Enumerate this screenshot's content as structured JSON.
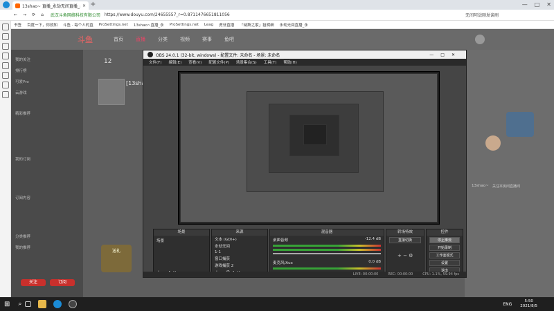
{
  "browser": {
    "tab_title": "13shao~ 直播_永劫无间直播_斗鱼",
    "url": "https://www.douyu.com/24655557_r=0.8711476651811056",
    "url_prefix": "武汉斗鱼网络科技有限公司",
    "right_text": "无间阿战刚发诶刷",
    "bookmarks": [
      "书签",
      "百度一下，你就知",
      "斗鱼 · 每个人的直",
      "ProSettings.net",
      "13shao~直播_永",
      "ProSettings.net",
      "Leag",
      "虎牙直播",
      "「纳斯之家」狙明细",
      "永劫无间直播_永"
    ]
  },
  "site": {
    "logo": "斗鱼",
    "nav": [
      "首页",
      "直播",
      "分类",
      "视频",
      "赛事",
      "鱼吧"
    ],
    "left_menu": [
      "我的关注",
      "排行榜",
      "可爱Pro",
      "云游戏",
      "精彩推荐",
      "我的订阅",
      "订阅内容",
      "分类推荐",
      "我的推荐"
    ],
    "follow_count": "12",
    "streamer": "[13sha",
    "right_label": "13shao~",
    "right_sub": "关注本房间直播间",
    "gift_label": "送礼",
    "bottom_buttons": [
      "关注",
      "订阅"
    ]
  },
  "obs": {
    "title": "OBS 24.0.1 (32-bit, windows) - 配置文件: 未命名 - 场景: 未命名",
    "menu": [
      "文件(F)",
      "编辑(E)",
      "查看(V)",
      "配置文件(P)",
      "场景集合(S)",
      "工具(T)",
      "帮助(H)"
    ],
    "docks": {
      "scenes": {
        "header": "场景",
        "items": [
          "场景"
        ]
      },
      "sources": {
        "header": "来源",
        "items": [
          "文本 (GDI+)",
          "永劫无间",
          "1-1",
          "窗口捕获",
          "游戏捕获 2"
        ]
      },
      "mixer": {
        "header": "混音器",
        "rows": [
          {
            "name": "桌面音频",
            "db": "-12.4 dB"
          },
          {
            "name": "麦克风/Aux",
            "db": "0.0 dB"
          }
        ]
      },
      "transitions": {
        "header": "转场特效",
        "mode": "直接切换"
      },
      "controls": {
        "header": "控件",
        "buttons": [
          "停止推流",
          "开始录制",
          "工作室模式",
          "设置",
          "退出"
        ]
      }
    },
    "status": [
      "LIVE: 00:00:00",
      "REC: 00:00:00",
      "CPU: 1.1%, 59.94 fps"
    ]
  },
  "taskbar": {
    "lang": "ENG",
    "time": "5:50",
    "date": "2021/8/5"
  }
}
